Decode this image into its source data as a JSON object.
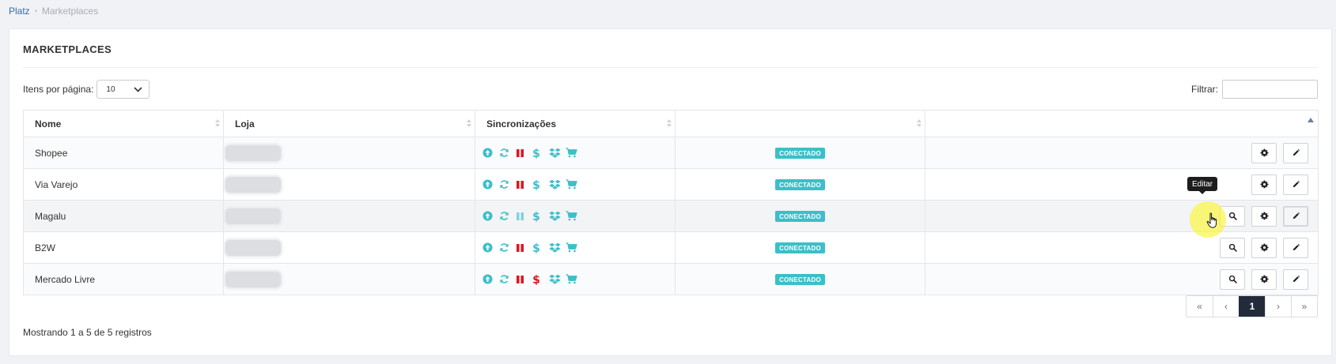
{
  "breadcrumb": {
    "root": "Platz",
    "separator": "•",
    "current": "Marketplaces"
  },
  "card": {
    "title": "MARKETPLACES"
  },
  "controls": {
    "per_page_label": "Itens por página:",
    "per_page_value": "10",
    "filter_label": "Filtrar:",
    "filter_value": ""
  },
  "table": {
    "columns": [
      "Nome",
      "Loja",
      "Sincronizações",
      "",
      ""
    ],
    "rows": [
      {
        "name": "Shopee",
        "store": "",
        "status": "CONECTADO",
        "pause_active": true,
        "price_alert": false,
        "has_search": false
      },
      {
        "name": "Via Varejo",
        "store": "",
        "status": "CONECTADO",
        "pause_active": true,
        "price_alert": false,
        "has_search": false
      },
      {
        "name": "Magalu",
        "store": "",
        "status": "CONECTADO",
        "pause_active": false,
        "price_alert": false,
        "has_search": true
      },
      {
        "name": "B2W",
        "store": "",
        "status": "CONECTADO",
        "pause_active": true,
        "price_alert": false,
        "has_search": true
      },
      {
        "name": "Mercado Livre",
        "store": "",
        "status": "CONECTADO",
        "pause_active": true,
        "price_alert": true,
        "has_search": true
      }
    ],
    "sync_icons": [
      "upload-circle-icon",
      "refresh-icon",
      "pause-icon",
      "dollar-icon",
      "dropbox-icon",
      "cart-icon"
    ]
  },
  "footer": {
    "info": "Mostrando 1 a 5 de 5 registros"
  },
  "pagination": {
    "first": "«",
    "prev": "‹",
    "current": "1",
    "next": "›",
    "last": "»"
  },
  "tooltip": {
    "text": "Editar"
  },
  "colors": {
    "teal": "#3bbfc9",
    "red": "#e0151c",
    "pause_inactive": "#7fd3da",
    "dark": "#232b3a"
  }
}
